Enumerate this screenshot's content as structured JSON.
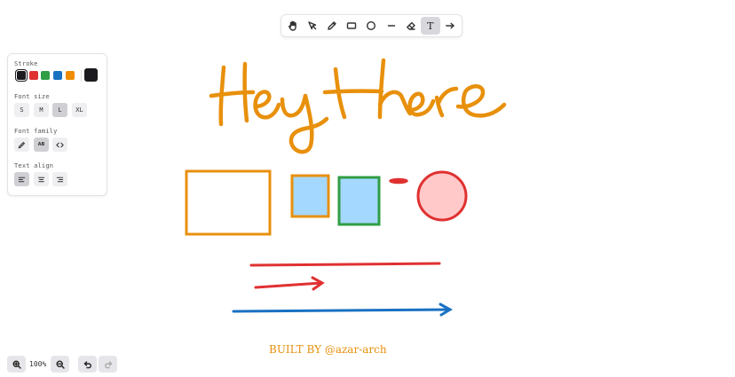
{
  "toolbar": {
    "tools": [
      {
        "name": "hand",
        "icon": "hand-icon"
      },
      {
        "name": "select",
        "icon": "cursor-icon"
      },
      {
        "name": "draw",
        "icon": "pencil-icon"
      },
      {
        "name": "rectangle",
        "icon": "rectangle-icon"
      },
      {
        "name": "ellipse",
        "icon": "circle-icon"
      },
      {
        "name": "line",
        "icon": "line-icon"
      },
      {
        "name": "eraser",
        "icon": "eraser-icon"
      },
      {
        "name": "text",
        "icon": "text-icon",
        "active": true
      },
      {
        "name": "arrow",
        "icon": "arrow-icon"
      }
    ],
    "text_tool_glyph": "T"
  },
  "props": {
    "stroke_label": "Stroke",
    "stroke_colors": [
      "#1b1b1f",
      "#e03131",
      "#2f9e44",
      "#1971c2",
      "#f08c00"
    ],
    "selected_stroke": "#1b1b1f",
    "custom_color": "#1b1b1f",
    "font_size_label": "Font size",
    "font_sizes": [
      "S",
      "M",
      "L",
      "XL"
    ],
    "selected_font_size": "L",
    "font_family_label": "Font family",
    "font_family_options": [
      "hand-drawn-icon",
      "normal-font-icon",
      "code-icon"
    ],
    "font_family_normal_glyph": "AB",
    "selected_font_family": "normal",
    "text_align_label": "Text align",
    "text_align_options": [
      "align-left-icon",
      "align-center-icon",
      "align-right-icon"
    ],
    "selected_text_align": "left"
  },
  "zoom": {
    "level": "100%"
  },
  "canvas": {
    "handwriting": "Hey there",
    "colors": {
      "orange": "#e8900c",
      "red": "#e03131",
      "green": "#2f9e44",
      "blue": "#1971c2",
      "light_blue_fill": "#a5d8ff",
      "pink_fill": "#ffc9c9"
    }
  },
  "credit": "BUILT BY @azar-arch"
}
